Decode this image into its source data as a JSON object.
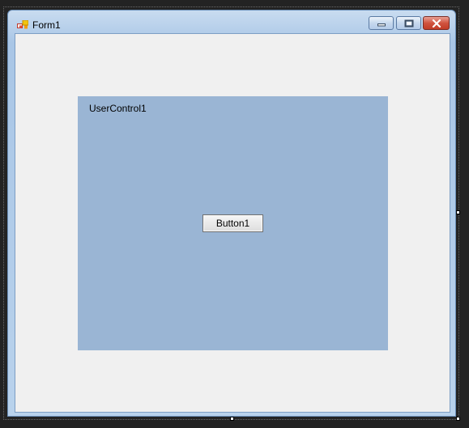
{
  "form": {
    "title": "Form1",
    "icon": "form-app-icon"
  },
  "caption_buttons": {
    "minimize_icon": "minimize-icon",
    "maximize_icon": "maximize-icon",
    "close_icon": "close-icon"
  },
  "user_control": {
    "label": "UserControl1",
    "background_color": "#9ab5d4"
  },
  "button1": {
    "label": "Button1"
  },
  "colors": {
    "client_area": "#f0f0f0",
    "close_button": "#c94a35"
  }
}
